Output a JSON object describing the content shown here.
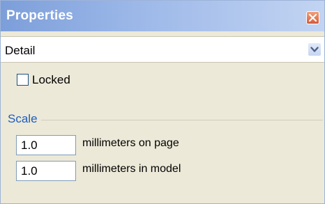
{
  "window": {
    "title": "Properties",
    "close_icon": "close-icon",
    "accent": "#7c9ed9"
  },
  "dropdown": {
    "selected": "Detail",
    "arrow_icon": "chevron-down-icon"
  },
  "locked": {
    "label": "Locked",
    "checked": false
  },
  "scale": {
    "group_label": "Scale",
    "page_value": "1.0",
    "page_label": "millimeters on page",
    "model_value": "1.0",
    "model_label": "millimeters in model"
  }
}
